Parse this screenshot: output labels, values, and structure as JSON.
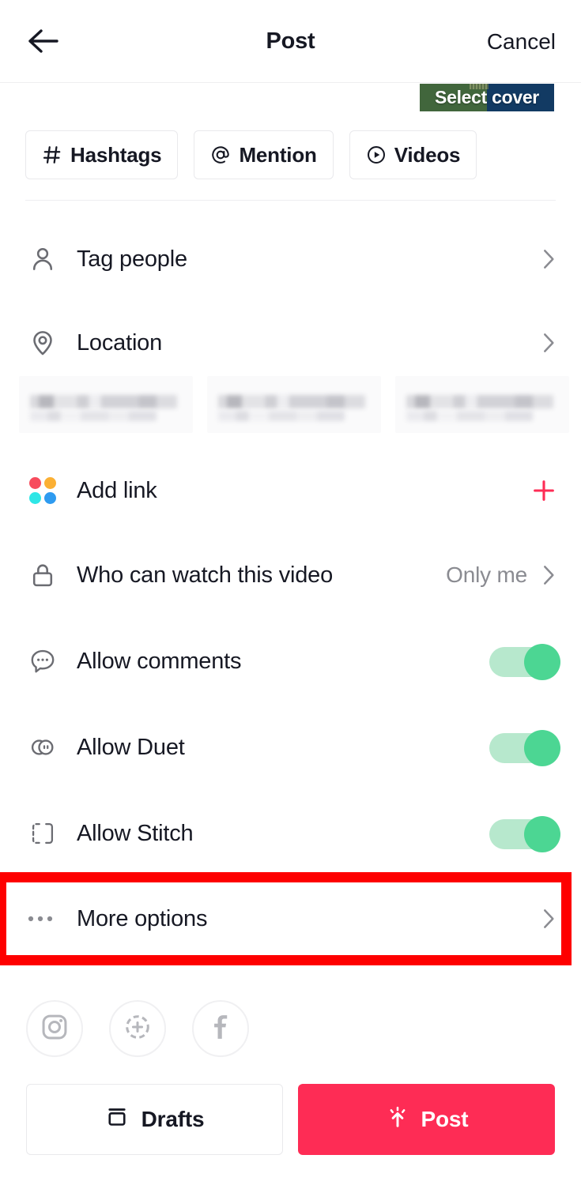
{
  "header": {
    "title": "Post",
    "back_icon": "arrow-left-icon",
    "cancel_label": "Cancel"
  },
  "cover": {
    "label": "Select cover",
    "left_color": "#41663c",
    "right_color": "#123a63"
  },
  "chips": [
    {
      "label": "Hashtags",
      "icon": "hash-icon"
    },
    {
      "label": "Mention",
      "icon": "at-icon"
    },
    {
      "label": "Videos",
      "icon": "play-circle-icon"
    }
  ],
  "rows": {
    "tag_people": {
      "label": "Tag people",
      "icon": "person-icon",
      "chevron": "chevron-right-icon"
    },
    "location": {
      "label": "Location",
      "icon": "location-pin-icon",
      "chevron": "chevron-right-icon"
    },
    "add_link": {
      "label": "Add link",
      "icon": "four-dots-icon",
      "action": "plus-icon",
      "action_color": "#fe2c55"
    },
    "who_can_watch": {
      "label": "Who can watch this video",
      "icon": "lock-icon",
      "value": "Only me",
      "chevron": "chevron-right-icon"
    },
    "allow_comments": {
      "label": "Allow comments",
      "icon": "comment-bubble-icon",
      "toggle": "on"
    },
    "allow_duet": {
      "label": "Allow Duet",
      "icon": "duet-circles-icon",
      "toggle": "on"
    },
    "allow_stitch": {
      "label": "Allow Stitch",
      "icon": "stitch-bracket-icon",
      "toggle": "on"
    },
    "more_options": {
      "label": "More options",
      "icon": "ellipsis-icon",
      "chevron": "chevron-right-icon"
    }
  },
  "link_icon_colors": {
    "top_left": "#f74c5d",
    "top_right": "#fbb034",
    "bottom_left": "#2ee6e6",
    "bottom_right": "#2e9bf0"
  },
  "toggle_colors": {
    "track": "#b7e8cd",
    "knob": "#4cd693"
  },
  "location_suggestions": [
    {
      "redacted": true
    },
    {
      "redacted": true
    },
    {
      "redacted": true
    },
    {
      "redacted": true
    }
  ],
  "share_targets": [
    {
      "name": "Instagram",
      "icon": "instagram-icon"
    },
    {
      "name": "Instagram Stories",
      "icon": "instagram-stories-icon"
    },
    {
      "name": "Facebook",
      "icon": "facebook-icon"
    }
  ],
  "footer": {
    "drafts_label": "Drafts",
    "drafts_icon": "drafts-box-icon",
    "post_label": "Post",
    "post_icon": "upload-sparkle-icon",
    "post_color": "#fe2c55"
  },
  "annotation": {
    "target": "More options",
    "color": "#fe0000"
  }
}
